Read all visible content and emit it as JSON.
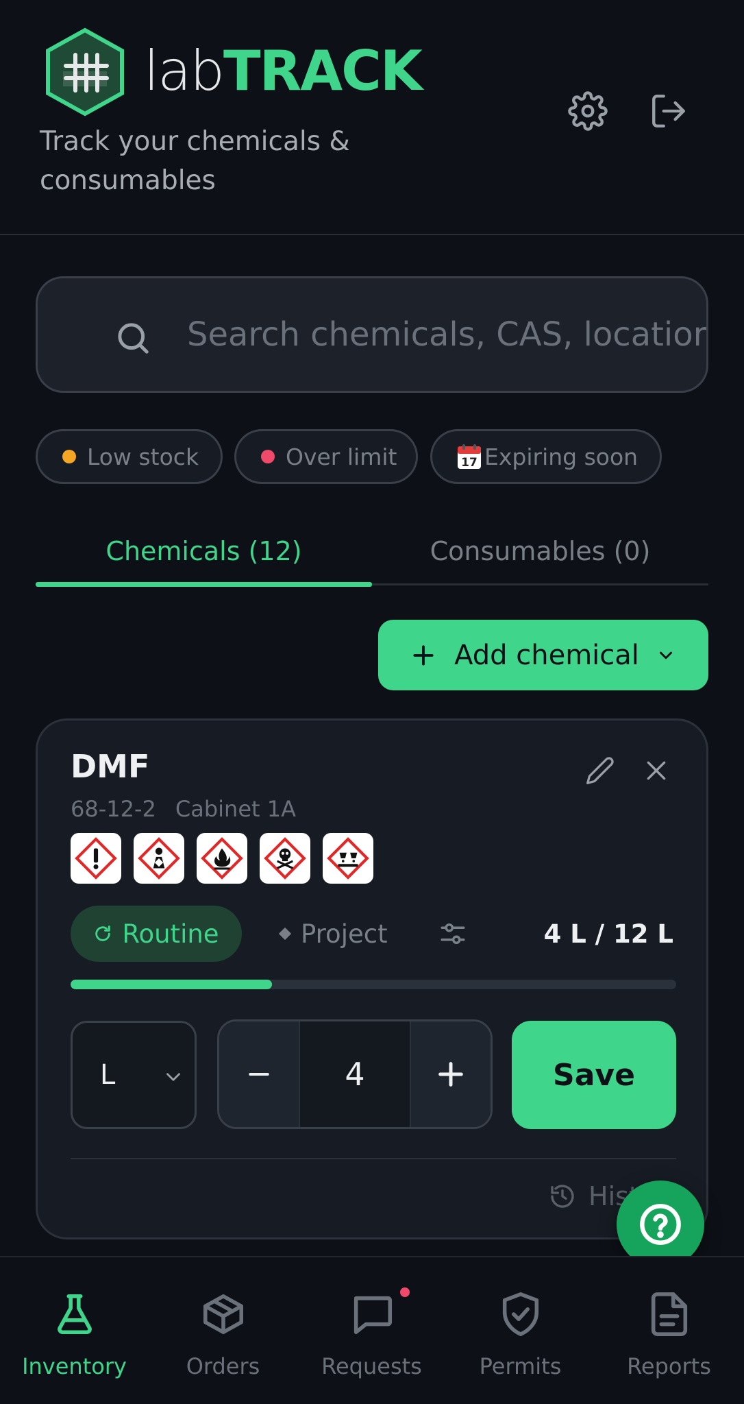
{
  "brand": {
    "prefix": "lab",
    "suffix": "TRACK",
    "tagline": "Track your chemicals & consumables"
  },
  "header": {
    "settings_icon": "gear-icon",
    "logout_icon": "logout-icon"
  },
  "search": {
    "placeholder": "Search chemicals, CAS, locatior"
  },
  "filters": [
    {
      "label": "Low stock",
      "dot_color": "#f5a623"
    },
    {
      "label": "Over limit",
      "dot_color": "#f04a6a"
    },
    {
      "label": "Expiring soon",
      "icon": "calendar-icon"
    }
  ],
  "tabs": [
    {
      "label": "Chemicals (12)",
      "active": true
    },
    {
      "label": "Consumables (0)",
      "active": false
    }
  ],
  "add_button": {
    "label": "Add chemical"
  },
  "chemical": {
    "name": "DMF",
    "cas": "68-12-2",
    "location": "Cabinet 1A",
    "hazards": [
      "exclamation-mark-pictogram",
      "health-hazard-pictogram",
      "flame-pictogram",
      "skull-crossbones-pictogram",
      "corrosion-pictogram"
    ],
    "usage_routine": "Routine",
    "usage_project": "Project",
    "quantity_text": "4 L / 12 L",
    "fill_fraction": 0.333,
    "unit": "L",
    "amount": "4",
    "save_label": "Save",
    "history_label": "Hist"
  },
  "nav": [
    {
      "label": "Inventory",
      "icon": "flask-icon",
      "active": true
    },
    {
      "label": "Orders",
      "icon": "box-icon",
      "active": false
    },
    {
      "label": "Requests",
      "icon": "chat-icon",
      "active": false,
      "badge": true
    },
    {
      "label": "Permits",
      "icon": "shield-check-icon",
      "active": false
    },
    {
      "label": "Reports",
      "icon": "document-icon",
      "active": false
    }
  ],
  "colors": {
    "accent": "#3fd58a",
    "background": "#0d1117",
    "card": "#171c24",
    "warning": "#f5a623",
    "danger": "#f04a6a"
  }
}
